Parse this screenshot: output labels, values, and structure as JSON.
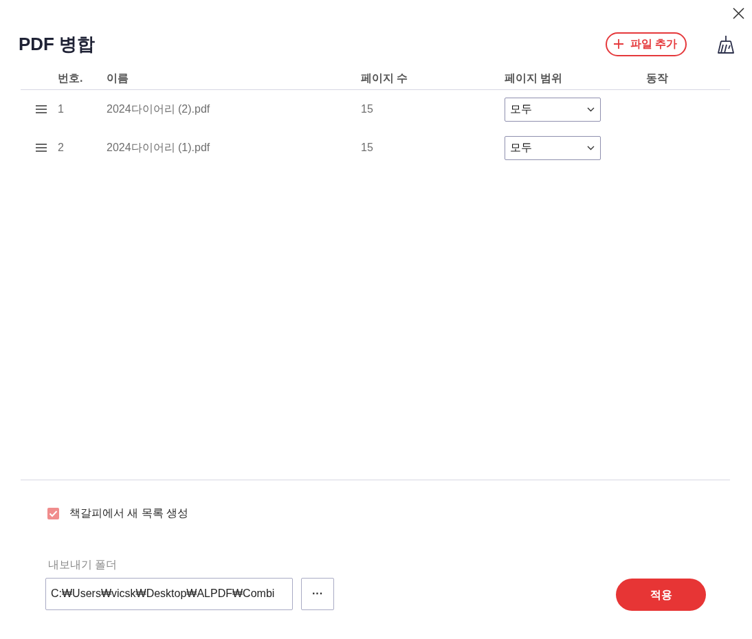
{
  "window": {
    "title": "PDF 병합"
  },
  "toolbar": {
    "add_file_button": "파일 추가"
  },
  "table": {
    "columns": [
      "번호.",
      "이름",
      "페이지 수",
      "페이지 범위",
      "동작"
    ],
    "rows": [
      {
        "number": "1",
        "name": "2024다이어리 (2).pdf",
        "pages": "15",
        "range": "모두"
      },
      {
        "number": "2",
        "name": "2024다이어리 (1).pdf",
        "pages": "15",
        "range": "모두"
      }
    ]
  },
  "bookmark_option": {
    "label": "책갈피에서 새 목록 생성",
    "checked": true
  },
  "export_folder": {
    "label": "내보내기 폴더",
    "value": "C:₩Users₩vicsk₩Desktop₩ALPDF₩Combi",
    "browse_button": "···"
  },
  "apply_button": "적용"
}
